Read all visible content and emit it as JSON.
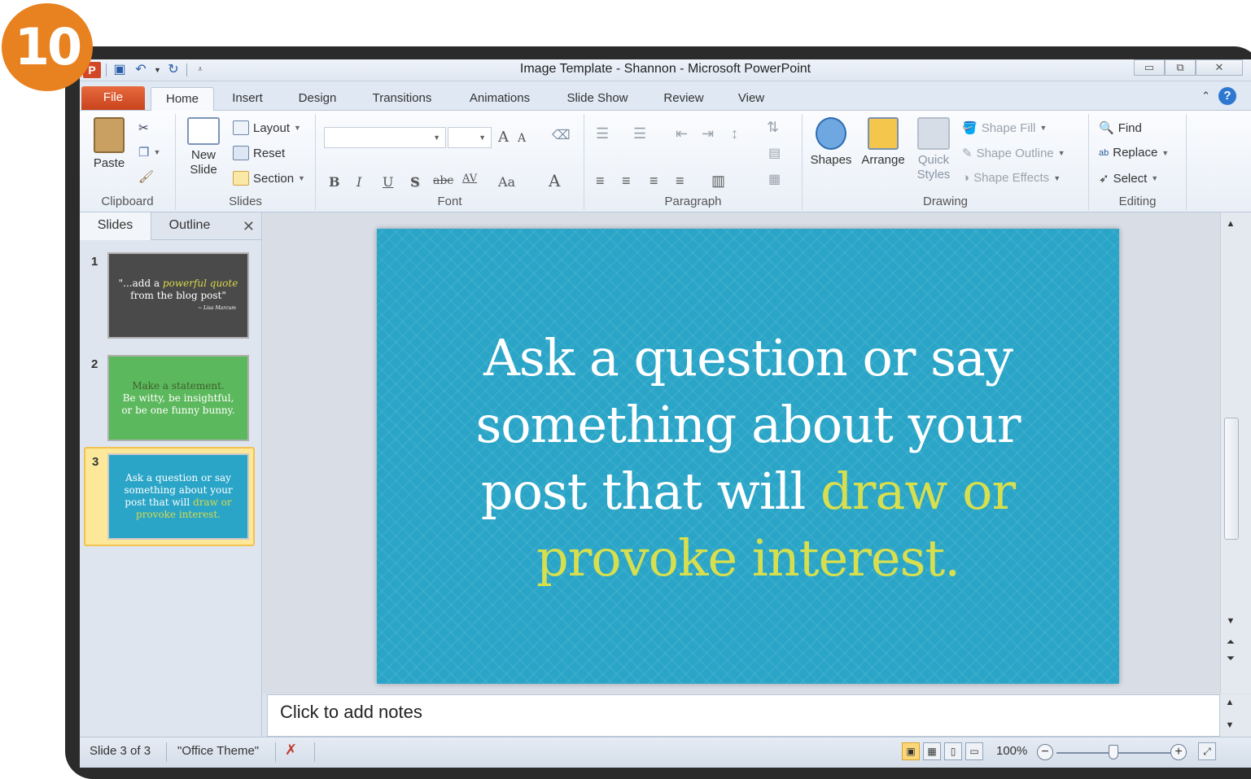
{
  "step_badge": "10",
  "window": {
    "title": "Image Template - Shannon  -  Microsoft PowerPoint",
    "controls": {
      "minimize": "▭",
      "restore": "⧉",
      "close": "✕"
    }
  },
  "tabs": [
    "File",
    "Home",
    "Insert",
    "Design",
    "Transitions",
    "Animations",
    "Slide Show",
    "Review",
    "View"
  ],
  "active_tab": "Home",
  "ribbon": {
    "clipboard": {
      "paste": "Paste",
      "label": "Clipboard"
    },
    "slides": {
      "new_slide": "New Slide",
      "layout": "Layout",
      "reset": "Reset",
      "section": "Section",
      "label": "Slides"
    },
    "font": {
      "label": "Font",
      "grow": "A",
      "shrink": "A",
      "bold": "B",
      "italic": "I",
      "underline": "U",
      "shadow": "S",
      "strike": "abc",
      "spacing": "AV",
      "case": "Aa",
      "color": "A"
    },
    "paragraph": {
      "label": "Paragraph"
    },
    "drawing": {
      "shapes": "Shapes",
      "arrange": "Arrange",
      "quick_styles": "Quick Styles",
      "shape_fill": "Shape Fill",
      "shape_outline": "Shape Outline",
      "shape_effects": "Shape Effects",
      "label": "Drawing"
    },
    "editing": {
      "find": "Find",
      "replace": "Replace",
      "select": "Select",
      "label": "Editing"
    }
  },
  "left_pane": {
    "tabs": [
      "Slides",
      "Outline"
    ],
    "close": "✕",
    "slides": [
      {
        "num": "1",
        "bg": "#4a4a4a",
        "line1_a": "\"...add a ",
        "line1_b": "powerful quote",
        "line2": "from the blog post\"",
        "line3": "~ Lisa Marcum"
      },
      {
        "num": "2",
        "bg": "#5cb85c",
        "line1": "Make a statement.",
        "line2": "Be witty, be insightful,",
        "line3": "or be one funny bunny."
      },
      {
        "num": "3",
        "bg": "#2aa5c7",
        "line1": "Ask a question or say",
        "line2": "something about your",
        "line3_a": "post that will ",
        "line3_b": "draw or",
        "line4": "provoke interest."
      }
    ]
  },
  "slide": {
    "line1": "Ask a question or say",
    "line2": "something about your",
    "line3_a": "post that will ",
    "line3_b": "draw or",
    "line4": "provoke interest."
  },
  "notes": {
    "placeholder": "Click to add notes"
  },
  "status": {
    "slide_info": "Slide 3 of 3",
    "theme": "\"Office Theme\"",
    "zoom": "100%"
  }
}
